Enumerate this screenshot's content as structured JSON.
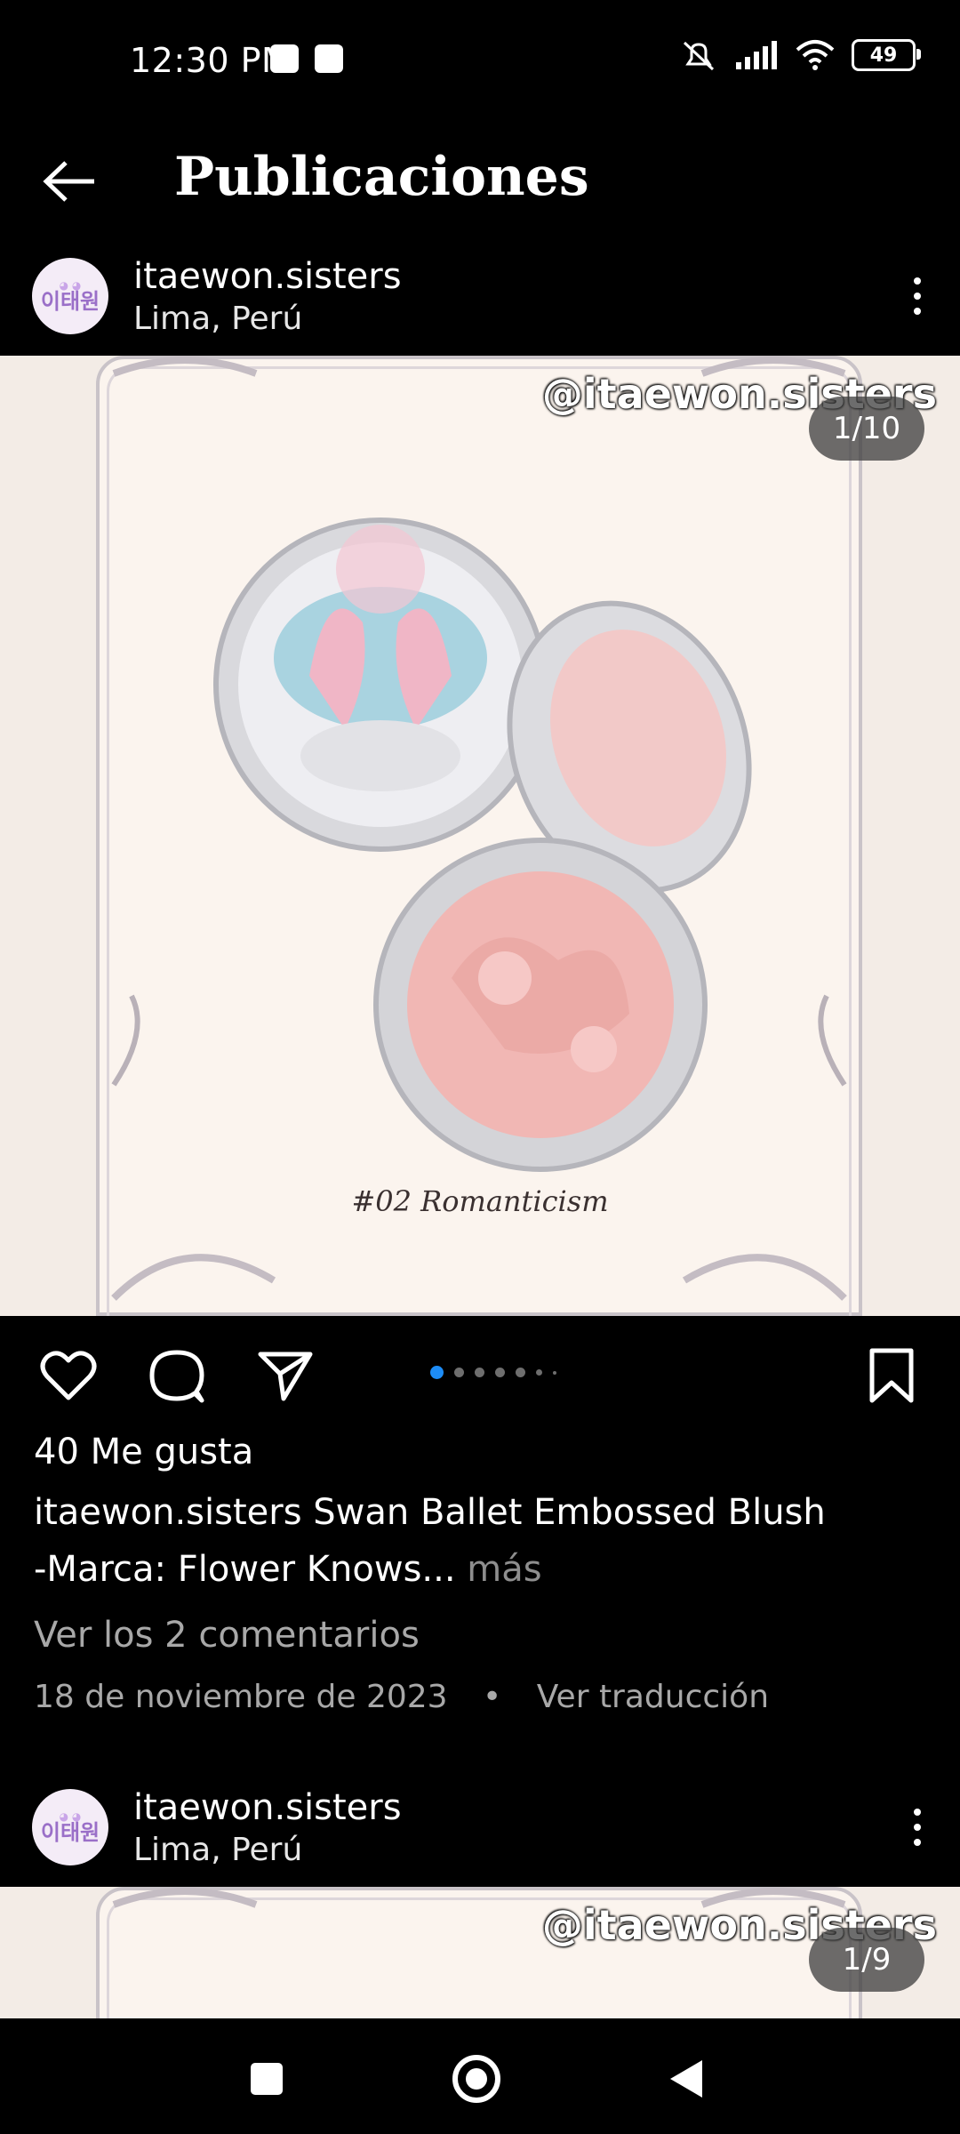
{
  "status": {
    "time": "12:30 PM",
    "battery": "49"
  },
  "header": {
    "title": "Publicaciones"
  },
  "posts": [
    {
      "avatar_text": "이태원",
      "username": "itaewon.sisters",
      "location": "Lima, Perú",
      "watermark": "@itaewon.sisters",
      "counter": "1/10",
      "image_caption": "#02 Romanticism",
      "likes": "40 Me gusta",
      "caption_user": "itaewon.sisters",
      "caption_line1": "Swan Ballet Embossed Blush",
      "caption_line2": "-Marca: Flower Knows...",
      "more": "más",
      "comments": "Ver los 2 comentarios",
      "date": "18 de noviembre de 2023",
      "separator": "•",
      "translate": "Ver traducción"
    },
    {
      "avatar_text": "이태원",
      "username": "itaewon.sisters",
      "location": "Lima, Perú",
      "watermark": "@itaewon.sisters",
      "counter": "1/9"
    }
  ],
  "icons": {
    "back": "arrow-left-icon",
    "like": "heart-icon",
    "comment": "comment-icon",
    "share": "send-icon",
    "save": "bookmark-icon",
    "more": "more-vertical-icon",
    "nav_recents": "square-icon",
    "nav_home": "circle-icon",
    "nav_back": "triangle-back-icon"
  },
  "colors": {
    "accent": "#1d8cf6",
    "background": "#000000",
    "muted": "#a8a8a8"
  },
  "carousel": {
    "total_dots": 7,
    "active_index": 0
  }
}
